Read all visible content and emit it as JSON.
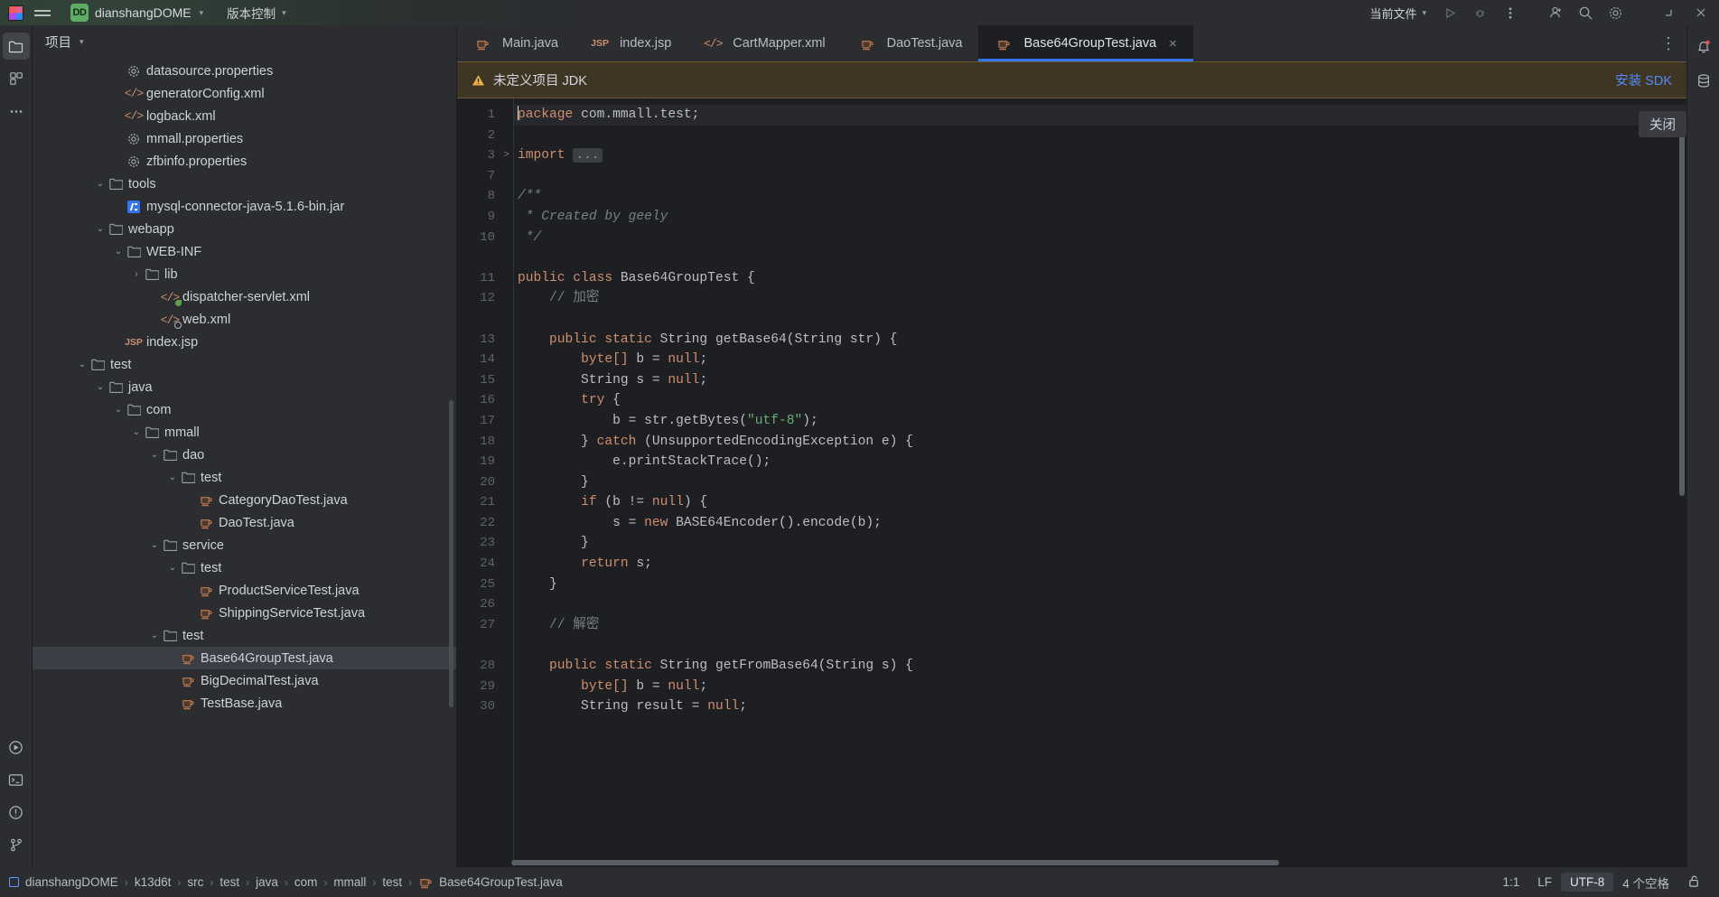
{
  "titlebar": {
    "project_badge": "DD",
    "project_name": "dianshangDOME",
    "vcs_label": "版本控制",
    "current_file_label": "当前文件",
    "icons": [
      "run-icon",
      "debug-icon",
      "more-actions-icon",
      "add-service-icon",
      "search-icon",
      "settings-icon",
      "minimize-icon",
      "close-icon"
    ]
  },
  "left_rail": {
    "items": [
      {
        "name": "project-tool-icon",
        "active": true
      },
      {
        "name": "commit-tool-icon",
        "active": false
      },
      {
        "name": "more-tool-icon",
        "active": false
      },
      {
        "name": "run-tool-icon",
        "active": false
      },
      {
        "name": "terminal-tool-icon",
        "active": false
      },
      {
        "name": "problems-tool-icon",
        "active": false
      },
      {
        "name": "version-control-tool-icon",
        "active": false
      }
    ]
  },
  "right_rail": {
    "items": [
      {
        "name": "notifications-icon"
      },
      {
        "name": "database-icon"
      }
    ]
  },
  "project_panel": {
    "title": "项目",
    "tree": [
      {
        "indent": 4,
        "arrow": "",
        "icon": "gear-icon",
        "label": "datasource.properties"
      },
      {
        "indent": 4,
        "arrow": "",
        "icon": "xml-icon",
        "label": "generatorConfig.xml"
      },
      {
        "indent": 4,
        "arrow": "",
        "icon": "xml-icon",
        "label": "logback.xml"
      },
      {
        "indent": 4,
        "arrow": "",
        "icon": "gear-icon",
        "label": "mmall.properties"
      },
      {
        "indent": 4,
        "arrow": "",
        "icon": "gear-icon",
        "label": "zfbinfo.properties"
      },
      {
        "indent": 3,
        "arrow": "v",
        "icon": "folder-icon",
        "label": "tools"
      },
      {
        "indent": 4,
        "arrow": "",
        "icon": "jar-icon",
        "label": "mysql-connector-java-5.1.6-bin.jar"
      },
      {
        "indent": 3,
        "arrow": "v",
        "icon": "folder-icon",
        "label": "webapp"
      },
      {
        "indent": 4,
        "arrow": "v",
        "icon": "folder-icon",
        "label": "WEB-INF"
      },
      {
        "indent": 5,
        "arrow": ">",
        "icon": "folder-icon",
        "label": "lib"
      },
      {
        "indent": 6,
        "arrow": "",
        "icon": "xml-spring-icon",
        "label": "dispatcher-servlet.xml"
      },
      {
        "indent": 6,
        "arrow": "",
        "icon": "xml-web-icon",
        "label": "web.xml"
      },
      {
        "indent": 4,
        "arrow": "",
        "icon": "jsp-icon",
        "label": "index.jsp"
      },
      {
        "indent": 2,
        "arrow": "v",
        "icon": "folder-icon",
        "label": "test"
      },
      {
        "indent": 3,
        "arrow": "v",
        "icon": "folder-icon",
        "label": "java"
      },
      {
        "indent": 4,
        "arrow": "v",
        "icon": "folder-icon",
        "label": "com"
      },
      {
        "indent": 5,
        "arrow": "v",
        "icon": "folder-icon",
        "label": "mmall"
      },
      {
        "indent": 6,
        "arrow": "v",
        "icon": "folder-icon",
        "label": "dao"
      },
      {
        "indent": 7,
        "arrow": "v",
        "icon": "folder-icon",
        "label": "test"
      },
      {
        "indent": 8,
        "arrow": "",
        "icon": "java-icon",
        "label": "CategoryDaoTest.java"
      },
      {
        "indent": 8,
        "arrow": "",
        "icon": "java-icon",
        "label": "DaoTest.java"
      },
      {
        "indent": 6,
        "arrow": "v",
        "icon": "folder-icon",
        "label": "service"
      },
      {
        "indent": 7,
        "arrow": "v",
        "icon": "folder-icon",
        "label": "test"
      },
      {
        "indent": 8,
        "arrow": "",
        "icon": "java-icon",
        "label": "ProductServiceTest.java"
      },
      {
        "indent": 8,
        "arrow": "",
        "icon": "java-icon",
        "label": "ShippingServiceTest.java"
      },
      {
        "indent": 6,
        "arrow": "v",
        "icon": "folder-icon",
        "label": "test"
      },
      {
        "indent": 7,
        "arrow": "",
        "icon": "java-icon",
        "label": "Base64GroupTest.java",
        "selected": true
      },
      {
        "indent": 7,
        "arrow": "",
        "icon": "java-icon",
        "label": "BigDecimalTest.java"
      },
      {
        "indent": 7,
        "arrow": "",
        "icon": "java-icon",
        "label": "TestBase.java"
      }
    ]
  },
  "editor": {
    "tabs": [
      {
        "label": "Main.java",
        "icon": "java-icon",
        "active": false,
        "closable": false
      },
      {
        "label": "index.jsp",
        "icon": "jsp-icon",
        "active": false,
        "closable": false
      },
      {
        "label": "CartMapper.xml",
        "icon": "xml-icon",
        "active": false,
        "closable": false
      },
      {
        "label": "DaoTest.java",
        "icon": "java-icon",
        "active": false,
        "closable": false
      },
      {
        "label": "Base64GroupTest.java",
        "icon": "java-icon",
        "active": true,
        "closable": true,
        "close_label": "×"
      }
    ],
    "more_tabs_label": "⋮",
    "banner": {
      "icon": "warning-icon",
      "message": "未定义项目 JDK",
      "action_label": "安装 SDK",
      "close_label": "关闭"
    },
    "lines": [
      {
        "num": "1",
        "fold": "",
        "text": "package com.mmall.test;",
        "type": "pkg",
        "current": true
      },
      {
        "num": "2",
        "fold": "",
        "text": "",
        "type": "plain"
      },
      {
        "num": "3",
        "fold": ">",
        "text": "import ...",
        "type": "import"
      },
      {
        "num": "7",
        "fold": "",
        "text": "",
        "type": "plain"
      },
      {
        "num": "8",
        "fold": "",
        "text": "/**",
        "type": "comment"
      },
      {
        "num": "9",
        "fold": "",
        "text": " * Created by geely",
        "type": "comment"
      },
      {
        "num": "10",
        "fold": "",
        "text": " */",
        "type": "comment"
      },
      {
        "num": "",
        "fold": "",
        "text": "",
        "type": "plain"
      },
      {
        "num": "11",
        "fold": "",
        "text": "public class Base64GroupTest {",
        "type": "classdecl"
      },
      {
        "num": "12",
        "fold": "",
        "text": "    // 加密",
        "type": "linecomment"
      },
      {
        "num": "",
        "fold": "",
        "text": "",
        "type": "plain"
      },
      {
        "num": "13",
        "fold": "",
        "text": "    public static String getBase64(String str) {",
        "type": "method"
      },
      {
        "num": "14",
        "fold": "",
        "text": "        byte[] b = null;",
        "type": "stmt_byte"
      },
      {
        "num": "15",
        "fold": "",
        "text": "        String s = null;",
        "type": "stmt_string"
      },
      {
        "num": "16",
        "fold": "",
        "text": "        try {",
        "type": "kw_try"
      },
      {
        "num": "17",
        "fold": "",
        "text": "            b = str.getBytes(\"utf-8\");",
        "type": "getbytes"
      },
      {
        "num": "18",
        "fold": "",
        "text": "        } catch (UnsupportedEncodingException e) {",
        "type": "kw_catch"
      },
      {
        "num": "19",
        "fold": "",
        "text": "            e.printStackTrace();",
        "type": "plain"
      },
      {
        "num": "20",
        "fold": "",
        "text": "        }",
        "type": "plain"
      },
      {
        "num": "21",
        "fold": "",
        "text": "        if (b != null) {",
        "type": "kw_if"
      },
      {
        "num": "22",
        "fold": "",
        "text": "            s = new BASE64Encoder().encode(b);",
        "type": "kw_new"
      },
      {
        "num": "23",
        "fold": "",
        "text": "        }",
        "type": "plain"
      },
      {
        "num": "24",
        "fold": "",
        "text": "        return s;",
        "type": "kw_return"
      },
      {
        "num": "25",
        "fold": "",
        "text": "    }",
        "type": "plain"
      },
      {
        "num": "26",
        "fold": "",
        "text": "",
        "type": "plain"
      },
      {
        "num": "27",
        "fold": "",
        "text": "    // 解密",
        "type": "linecomment"
      },
      {
        "num": "",
        "fold": "",
        "text": "",
        "type": "plain"
      },
      {
        "num": "28",
        "fold": "",
        "text": "    public static String getFromBase64(String s) {",
        "type": "method"
      },
      {
        "num": "29",
        "fold": "",
        "text": "        byte[] b = null;",
        "type": "stmt_byte"
      },
      {
        "num": "30",
        "fold": "",
        "text": "        String result = null;",
        "type": "stmt_string"
      }
    ]
  },
  "status_bar": {
    "breadcrumb": [
      "dianshangDOME",
      "k13d6t",
      "src",
      "test",
      "java",
      "com",
      "mmall",
      "test",
      "Base64GroupTest.java"
    ],
    "separator": "›",
    "caret_position": "1:1",
    "line_separator": "LF",
    "encoding": "UTF-8",
    "indent": "4 个空格",
    "lock_icon": "unlocked-icon"
  },
  "colors": {
    "accent": "#3574f0",
    "warning_bg": "#3f3525",
    "link": "#548af7",
    "keyword": "#cf8e6d",
    "string": "#6aab73",
    "comment": "#7a7e85",
    "editor_bg": "#1e1f22",
    "panel_bg": "#2b2d30"
  }
}
